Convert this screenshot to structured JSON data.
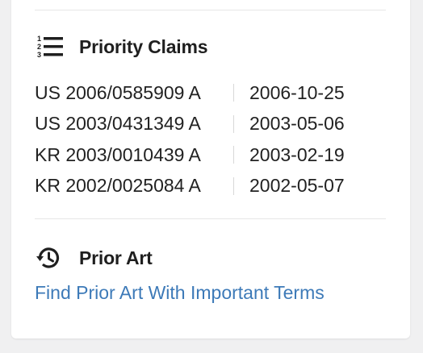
{
  "priority_claims": {
    "title": "Priority Claims",
    "icon": "numbered-list-icon",
    "claims": [
      {
        "number": "US 2006/0585909 A",
        "date": "2006-10-25"
      },
      {
        "number": "US 2003/0431349 A",
        "date": "2003-05-06"
      },
      {
        "number": "KR 2003/0010439 A",
        "date": "2003-02-19"
      },
      {
        "number": "KR 2002/0025084 A",
        "date": "2002-05-07"
      }
    ]
  },
  "prior_art": {
    "title": "Prior Art",
    "icon": "history-icon",
    "link_label": "Find Prior Art With Important Terms",
    "link_color": "#3d7ab8"
  }
}
